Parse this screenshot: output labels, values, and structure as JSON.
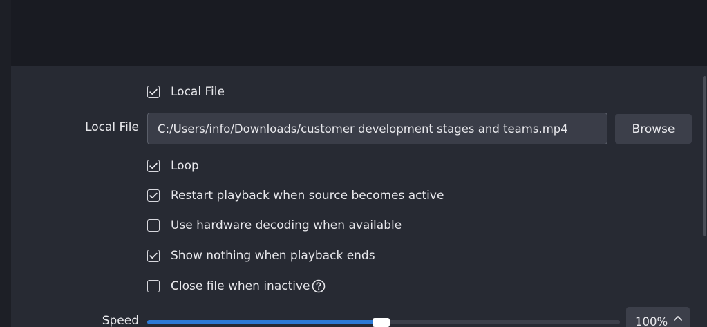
{
  "colors": {
    "background": "#1d1f26",
    "panel": "#272a33",
    "input_bg": "#3a3d48",
    "button_bg": "#3c3f4a",
    "accent": "#2c7ad6"
  },
  "local_file_toggle": {
    "label": "Local File",
    "checked": true
  },
  "local_file": {
    "label": "Local File",
    "value": "C:/Users/info/Downloads/customer development stages and teams.mp4",
    "browse_label": "Browse"
  },
  "options": [
    {
      "label": "Loop",
      "checked": true
    },
    {
      "label": "Restart playback when source becomes active",
      "checked": true
    },
    {
      "label": "Use hardware decoding when available",
      "checked": false
    },
    {
      "label": "Show nothing when playback ends",
      "checked": true
    },
    {
      "label": "Close file when inactive",
      "checked": false,
      "icon": "help-circle-icon"
    }
  ],
  "speed": {
    "label": "Speed",
    "value_text": "100%",
    "fraction": 0.495
  }
}
